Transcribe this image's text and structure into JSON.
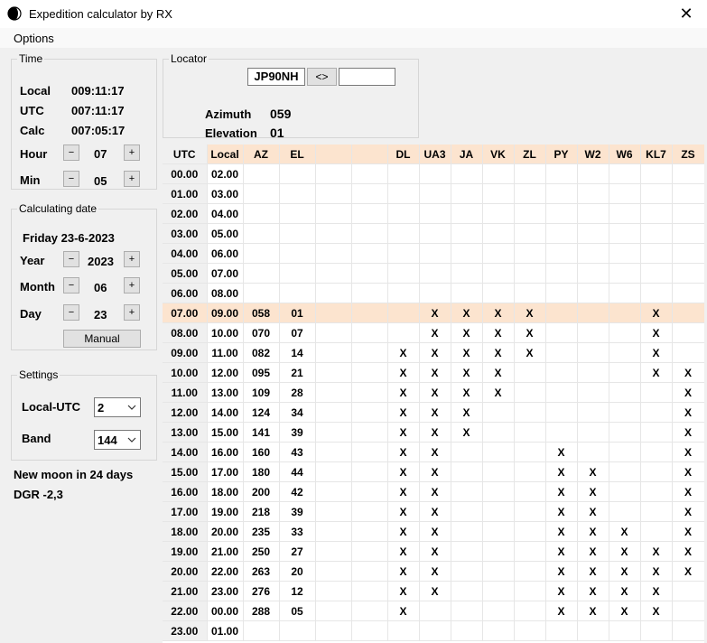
{
  "window": {
    "title": "Expedition calculator by RX"
  },
  "menu": {
    "options": "Options"
  },
  "time": {
    "legend": "Time",
    "local_label": "Local",
    "local_value": "009:11:17",
    "utc_label": "UTC",
    "utc_value": "007:11:17",
    "calc_label": "Calc",
    "calc_value": "007:05:17",
    "hour_label": "Hour",
    "hour_value": "07",
    "min_label": "Min",
    "min_value": "05",
    "minus": "−",
    "plus": "+"
  },
  "calc_date": {
    "legend": "Calculating date",
    "date_text": "Friday 23-6-2023",
    "year_label": "Year",
    "year_value": "2023",
    "month_label": "Month",
    "month_value": "06",
    "day_label": "Day",
    "day_value": "23",
    "manual_button": "Manual"
  },
  "settings": {
    "legend": "Settings",
    "local_utc_label": "Local-UTC",
    "local_utc_value": "2",
    "band_label": "Band",
    "band_value": "144"
  },
  "info": {
    "moon": "New moon in 24 days",
    "dgr": "DGR -2,3"
  },
  "locator": {
    "legend": "Locator",
    "value": "JP90NH",
    "swap_button": "<>",
    "second_value": "",
    "azimuth_label": "Azimuth",
    "azimuth_value": "059",
    "elevation_label": "Elevation",
    "elevation_value": "01"
  },
  "grid": {
    "headers": [
      "UTC",
      "Local",
      "AZ",
      "EL",
      "",
      "",
      "DL",
      "UA3",
      "JA",
      "VK",
      "ZL",
      "PY",
      "W2",
      "W6",
      "KL7",
      "ZS"
    ],
    "highlight_row": 7,
    "rows": [
      [
        "00.00",
        "02.00",
        "",
        "",
        "",
        "",
        "",
        "",
        "",
        "",
        "",
        "",
        "",
        "",
        "",
        ""
      ],
      [
        "01.00",
        "03.00",
        "",
        "",
        "",
        "",
        "",
        "",
        "",
        "",
        "",
        "",
        "",
        "",
        "",
        ""
      ],
      [
        "02.00",
        "04.00",
        "",
        "",
        "",
        "",
        "",
        "",
        "",
        "",
        "",
        "",
        "",
        "",
        "",
        ""
      ],
      [
        "03.00",
        "05.00",
        "",
        "",
        "",
        "",
        "",
        "",
        "",
        "",
        "",
        "",
        "",
        "",
        "",
        ""
      ],
      [
        "04.00",
        "06.00",
        "",
        "",
        "",
        "",
        "",
        "",
        "",
        "",
        "",
        "",
        "",
        "",
        "",
        ""
      ],
      [
        "05.00",
        "07.00",
        "",
        "",
        "",
        "",
        "",
        "",
        "",
        "",
        "",
        "",
        "",
        "",
        "",
        ""
      ],
      [
        "06.00",
        "08.00",
        "",
        "",
        "",
        "",
        "",
        "",
        "",
        "",
        "",
        "",
        "",
        "",
        "",
        ""
      ],
      [
        "07.00",
        "09.00",
        "058",
        "01",
        "",
        "",
        "",
        "X",
        "X",
        "X",
        "X",
        "",
        "",
        "",
        "X",
        ""
      ],
      [
        "08.00",
        "10.00",
        "070",
        "07",
        "",
        "",
        "",
        "X",
        "X",
        "X",
        "X",
        "",
        "",
        "",
        "X",
        ""
      ],
      [
        "09.00",
        "11.00",
        "082",
        "14",
        "",
        "",
        "X",
        "X",
        "X",
        "X",
        "X",
        "",
        "",
        "",
        "X",
        ""
      ],
      [
        "10.00",
        "12.00",
        "095",
        "21",
        "",
        "",
        "X",
        "X",
        "X",
        "X",
        "",
        "",
        "",
        "",
        "X",
        "X"
      ],
      [
        "11.00",
        "13.00",
        "109",
        "28",
        "",
        "",
        "X",
        "X",
        "X",
        "X",
        "",
        "",
        "",
        "",
        "",
        "X"
      ],
      [
        "12.00",
        "14.00",
        "124",
        "34",
        "",
        "",
        "X",
        "X",
        "X",
        "",
        "",
        "",
        "",
        "",
        "",
        "X"
      ],
      [
        "13.00",
        "15.00",
        "141",
        "39",
        "",
        "",
        "X",
        "X",
        "X",
        "",
        "",
        "",
        "",
        "",
        "",
        "X"
      ],
      [
        "14.00",
        "16.00",
        "160",
        "43",
        "",
        "",
        "X",
        "X",
        "",
        "",
        "",
        "X",
        "",
        "",
        "",
        "X"
      ],
      [
        "15.00",
        "17.00",
        "180",
        "44",
        "",
        "",
        "X",
        "X",
        "",
        "",
        "",
        "X",
        "X",
        "",
        "",
        "X"
      ],
      [
        "16.00",
        "18.00",
        "200",
        "42",
        "",
        "",
        "X",
        "X",
        "",
        "",
        "",
        "X",
        "X",
        "",
        "",
        "X"
      ],
      [
        "17.00",
        "19.00",
        "218",
        "39",
        "",
        "",
        "X",
        "X",
        "",
        "",
        "",
        "X",
        "X",
        "",
        "",
        "X"
      ],
      [
        "18.00",
        "20.00",
        "235",
        "33",
        "",
        "",
        "X",
        "X",
        "",
        "",
        "",
        "X",
        "X",
        "X",
        "",
        "X"
      ],
      [
        "19.00",
        "21.00",
        "250",
        "27",
        "",
        "",
        "X",
        "X",
        "",
        "",
        "",
        "X",
        "X",
        "X",
        "X",
        "X"
      ],
      [
        "20.00",
        "22.00",
        "263",
        "20",
        "",
        "",
        "X",
        "X",
        "",
        "",
        "",
        "X",
        "X",
        "X",
        "X",
        "X"
      ],
      [
        "21.00",
        "23.00",
        "276",
        "12",
        "",
        "",
        "X",
        "X",
        "",
        "",
        "",
        "X",
        "X",
        "X",
        "X",
        ""
      ],
      [
        "22.00",
        "00.00",
        "288",
        "05",
        "",
        "",
        "X",
        "",
        "",
        "",
        "",
        "X",
        "X",
        "X",
        "X",
        ""
      ],
      [
        "23.00",
        "01.00",
        "",
        "",
        "",
        "",
        "",
        "",
        "",
        "",
        "",
        "",
        "",
        "",
        "",
        ""
      ]
    ]
  }
}
